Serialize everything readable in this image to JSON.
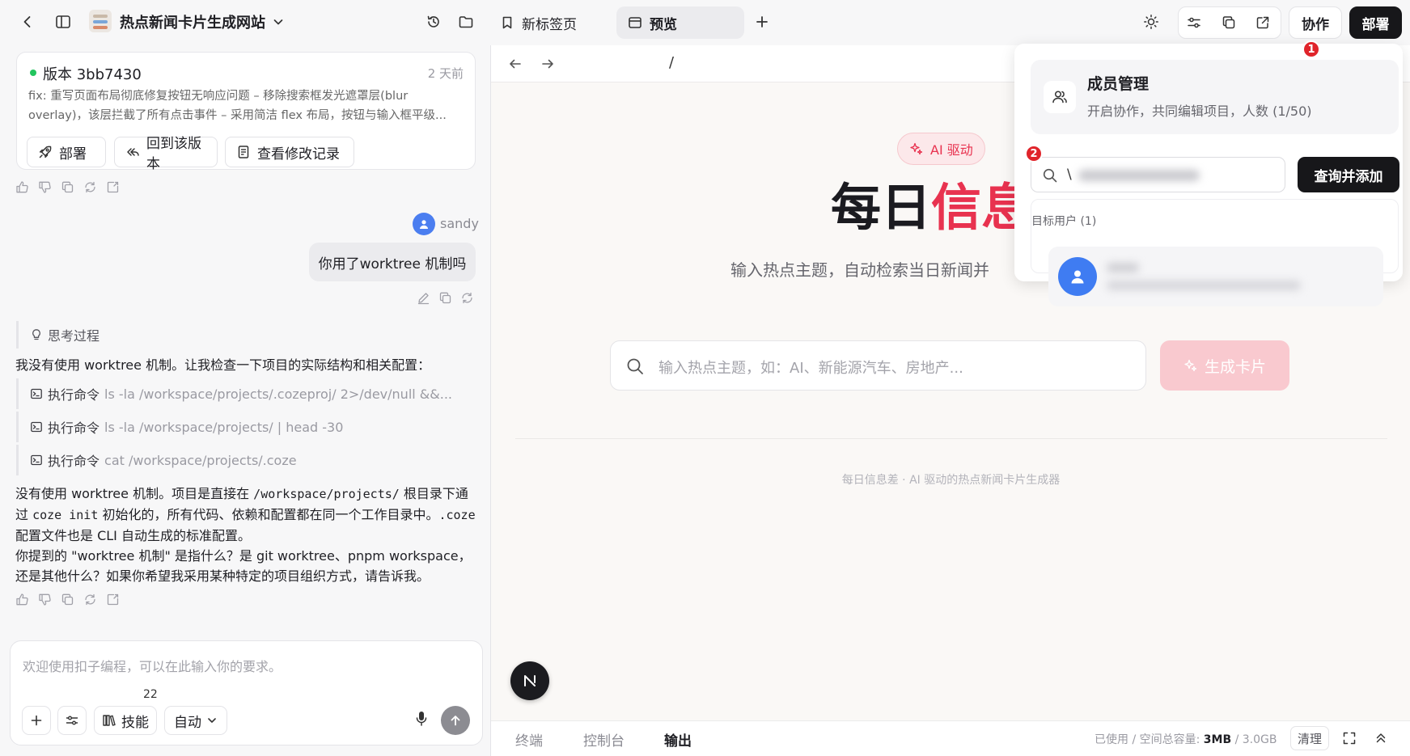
{
  "topbar": {
    "project_title": "热点新闻卡片生成网站",
    "tabs": [
      {
        "label": "新标签页",
        "icon": "bookmark-icon"
      },
      {
        "label": "预览",
        "icon": "browser-window-icon"
      }
    ],
    "collab_label": "协作",
    "deploy_label": "部署"
  },
  "version_card": {
    "title": "版本 3bb7430",
    "time": "2 天前",
    "desc_line1": "fix: 重写页面布局彻底修复按钮无响应问题 – 移除搜索框发光遮罩层(blur",
    "desc_line2": "overlay)，该层拦截了所有点击事件 – 采用简洁 flex 布局，按钮与输入框平级...",
    "buttons": {
      "deploy": "部署",
      "rollback": "回到该版本",
      "history": "查看修改记录"
    },
    "status_color": "#22c55e"
  },
  "chat": {
    "user_name": "sandy",
    "user_message": "你用了worktree 机制吗",
    "thinking_label": "思考过程",
    "intro": "我没有使用 worktree 机制。让我检查一下项目的实际结构和相关配置：",
    "cmd_prefix": "执行命令",
    "commands": [
      "ls -la /workspace/projects/.cozeproj/ 2>/dev/null &&...",
      "ls -la /workspace/projects/ | head -30",
      "cat /workspace/projects/.coze"
    ],
    "answer": {
      "p1_a": "没有使用 worktree 机制。项目是直接在 ",
      "p1_code1": "/workspace/projects/",
      "p1_b": " 根目录下通过 ",
      "p1_code2": "coze init",
      "p1_c": " 初始化的，所有代码、依赖和配置都在同一个工作目录中。",
      "p1_code3": ".coze",
      "p1_d": " 配置文件也是 CLI 自动生成的标准配置。",
      "p2": "你提到的 \"worktree 机制\" 是指什么？是 git worktree、pnpm workspace，还是其他什么？如果你希望我采用某种特定的项目组织方式，请告诉我。"
    }
  },
  "input": {
    "placeholder": "欢迎使用扣子编程，可以在此输入你的要求。",
    "skills_label": "技能",
    "skills_count": "22",
    "mode_label": "自动"
  },
  "preview": {
    "path": "/",
    "ai_badge": "AI 驱动",
    "hero_part1": "每日",
    "hero_part2": "信息",
    "subtitle": "输入热点主题，自动检索当日新闻并",
    "search_placeholder": "输入热点主题，如：AI、新能源汽车、房地产...",
    "generate_label": "生成卡片",
    "footer": "每日信息差 · AI 驱动的热点新闻卡片生成器",
    "accent_color": "#e8324f"
  },
  "bottombar": {
    "tabs": [
      "终端",
      "控制台",
      "输出"
    ],
    "usage_label": "已使用 / 空间总容量:",
    "usage_used": "3MB",
    "usage_sep": "/",
    "usage_total": "3.0GB",
    "clear_label": "清理"
  },
  "popover": {
    "title": "成员管理",
    "desc": "开启协作，共同编辑项目，人数 (1/50)",
    "search_value": "\\",
    "query_button": "查询并添加",
    "target_label": "目标用户 (1)",
    "badge1": "1",
    "badge2": "2"
  }
}
